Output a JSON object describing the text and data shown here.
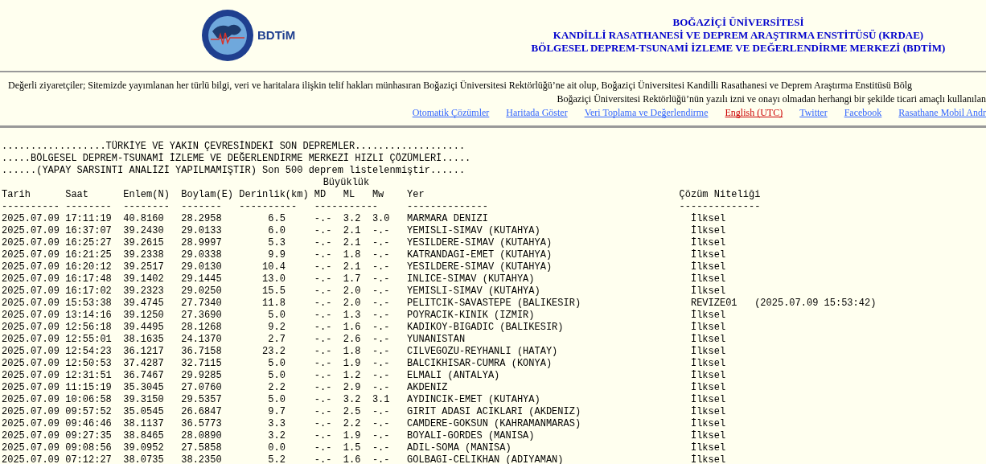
{
  "header": {
    "logo_text": "BDTiM",
    "titles": [
      "BOĞAZİÇİ ÜNİVERSİTESİ",
      "KANDİLLİ RASATHANESİ VE DEPREM ARAŞTIRMA ENSTİTÜSÜ (KRDAE)",
      "BÖLGESEL DEPREM-TSUNAMİ İZLEME VE DEĞERLENDİRME MERKEZİ (BDTİM)"
    ]
  },
  "notice": [
    "Değerli ziyaretçiler; Sitemizde yayımlanan her türlü bilgi, veri ve haritalara ilişkin telif hakları münhasıran Boğaziçi Üniversitesi Rektörlüğü’ne ait olup, Boğaziçi Üniversitesi Kandilli Rasathanesi ve Deprem Araştırma Enstitüsü Bölg",
    "Boğaziçi Üniversitesi Rektörlüğü’nün yazılı izni ve onayı olmadan herhangi bir şekilde ticari amaçlı kullanılan"
  ],
  "links": [
    {
      "label": "Otomatik Çözümler",
      "color": "#3366ff"
    },
    {
      "label": "Haritada Göster",
      "color": "#3366ff"
    },
    {
      "label": "Veri Toplama ve Değerlendirme",
      "color": "#3366ff"
    },
    {
      "label": "English (UTC)",
      "color": "#cc0000"
    },
    {
      "label": "Twitter",
      "color": "#3366ff"
    },
    {
      "label": "Facebook",
      "color": "#3366ff"
    },
    {
      "label": "Rasathane Mobil Andr",
      "color": "#3366ff"
    }
  ],
  "list_titles": [
    "..................TÜRKİYE VE YAKIN ÇEVRESİNDEKİ SON DEPREMLER...................",
    ".....BÖLGESEL DEPREM-TSUNAMİ İZLEME VE DEĞERLENDİRME MERKEZİ HIZLI ÇÖZÜMLERİ.....",
    "......(YAPAY SARSINTI ANALİZİ YAPILMAMIŞTIR) Son 500 deprem listelenmiştir......"
  ],
  "table": {
    "group_heading": "Büyüklük",
    "columns": [
      {
        "label": "Tarih",
        "rule": "----------"
      },
      {
        "label": "Saat",
        "rule": "--------"
      },
      {
        "label": "Enlem(N)",
        "rule": "--------"
      },
      {
        "label": "Boylam(E)",
        "rule": "-------"
      },
      {
        "label": "Derinlik(km)",
        "rule": "----------"
      },
      {
        "label": "MD",
        "rule": "-----------"
      },
      {
        "label": "ML"
      },
      {
        "label": "Mw"
      },
      {
        "label": "Yer",
        "rule": "--------------"
      },
      {
        "label": "Çözüm Niteliği",
        "rule": "--------------"
      }
    ],
    "rows": [
      [
        "2025.07.09",
        "17:11:19",
        "40.8160",
        "28.2958",
        "6.5",
        "-.-",
        "3.2",
        "3.0",
        "MARMARA DENIZI",
        "İlksel"
      ],
      [
        "2025.07.09",
        "16:37:07",
        "39.2430",
        "29.0133",
        "6.0",
        "-.-",
        "2.1",
        "-.-",
        "YEMISLI-SIMAV (KUTAHYA)",
        "İlksel"
      ],
      [
        "2025.07.09",
        "16:25:27",
        "39.2615",
        "28.9997",
        "5.3",
        "-.-",
        "2.1",
        "-.-",
        "YESILDERE-SIMAV (KUTAHYA)",
        "İlksel"
      ],
      [
        "2025.07.09",
        "16:21:25",
        "39.2338",
        "29.0338",
        "9.9",
        "-.-",
        "1.8",
        "-.-",
        "KATRANDAGI-EMET (KUTAHYA)",
        "İlksel"
      ],
      [
        "2025.07.09",
        "16:20:12",
        "39.2517",
        "29.0130",
        "10.4",
        "-.-",
        "2.1",
        "-.-",
        "YESILDERE-SIMAV (KUTAHYA)",
        "İlksel"
      ],
      [
        "2025.07.09",
        "16:17:48",
        "39.1402",
        "29.1445",
        "13.0",
        "-.-",
        "1.7",
        "-.-",
        "INLICE-SIMAV (KUTAHYA)",
        "İlksel"
      ],
      [
        "2025.07.09",
        "16:17:02",
        "39.2323",
        "29.0250",
        "15.5",
        "-.-",
        "2.0",
        "-.-",
        "YEMISLI-SIMAV (KUTAHYA)",
        "İlksel"
      ],
      [
        "2025.07.09",
        "15:53:38",
        "39.4745",
        "27.7340",
        "11.8",
        "-.-",
        "2.0",
        "-.-",
        "PELITCIK-SAVASTEPE (BALIKESIR)",
        "REVIZE01",
        "(2025.07.09 15:53:42)"
      ],
      [
        "2025.07.09",
        "13:14:16",
        "39.1250",
        "27.3690",
        "5.0",
        "-.-",
        "1.3",
        "-.-",
        "POYRACIK-KINIK (IZMIR)",
        "İlksel"
      ],
      [
        "2025.07.09",
        "12:56:18",
        "39.4495",
        "28.1268",
        "9.2",
        "-.-",
        "1.6",
        "-.-",
        "KADIKOY-BIGADIC (BALIKESIR)",
        "İlksel"
      ],
      [
        "2025.07.09",
        "12:55:01",
        "38.1635",
        "24.1370",
        "2.7",
        "-.-",
        "2.6",
        "-.-",
        "YUNANISTAN",
        "İlksel"
      ],
      [
        "2025.07.09",
        "12:54:23",
        "36.1217",
        "36.7158",
        "23.2",
        "-.-",
        "1.8",
        "-.-",
        "CILVEGOZU-REYHANLI (HATAY)",
        "İlksel"
      ],
      [
        "2025.07.09",
        "12:50:53",
        "37.4287",
        "32.7115",
        "5.0",
        "-.-",
        "1.9",
        "-.-",
        "BALCIKHISAR-CUMRA (KONYA)",
        "İlksel"
      ],
      [
        "2025.07.09",
        "12:31:51",
        "36.7467",
        "29.9285",
        "5.0",
        "-.-",
        "1.2",
        "-.-",
        "ELMALI (ANTALYA)",
        "İlksel"
      ],
      [
        "2025.07.09",
        "11:15:19",
        "35.3045",
        "27.0760",
        "2.2",
        "-.-",
        "2.9",
        "-.-",
        "AKDENIZ",
        "İlksel"
      ],
      [
        "2025.07.09",
        "10:06:58",
        "39.3150",
        "29.5357",
        "5.0",
        "-.-",
        "3.2",
        "3.1",
        "AYDINCIK-EMET (KUTAHYA)",
        "İlksel"
      ],
      [
        "2025.07.09",
        "09:57:52",
        "35.0545",
        "26.6847",
        "9.7",
        "-.-",
        "2.5",
        "-.-",
        "GIRIT ADASI ACIKLARI (AKDENIZ)",
        "İlksel"
      ],
      [
        "2025.07.09",
        "09:46:46",
        "38.1137",
        "36.5773",
        "3.3",
        "-.-",
        "2.2",
        "-.-",
        "CAMDERE-GOKSUN (KAHRAMANMARAS)",
        "İlksel"
      ],
      [
        "2025.07.09",
        "09:27:35",
        "38.8465",
        "28.0890",
        "3.2",
        "-.-",
        "1.9",
        "-.-",
        "BOYALI-GORDES (MANISA)",
        "İlksel"
      ],
      [
        "2025.07.09",
        "09:08:56",
        "39.0952",
        "27.5858",
        "0.0",
        "-.-",
        "1.5",
        "-.-",
        "ADIL-SOMA (MANISA)",
        "İlksel"
      ],
      [
        "2025.07.09",
        "07:12:27",
        "38.0735",
        "38.2350",
        "5.2",
        "-.-",
        "1.6",
        "-.-",
        "GOLBAGI-CELIKHAN (ADIYAMAN)",
        "İlksel"
      ]
    ]
  }
}
